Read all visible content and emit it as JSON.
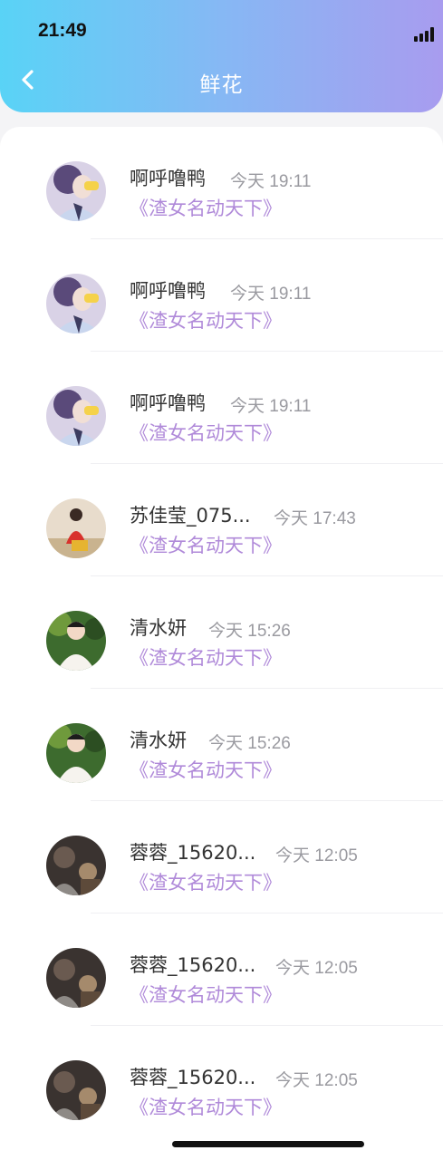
{
  "status_bar": {
    "time": "21:49"
  },
  "header": {
    "title": "鲜花",
    "back_icon": "chevron-left-icon"
  },
  "accent_colors": {
    "gradient_start": "#59d3f6",
    "gradient_end": "#a89cef",
    "book_text": "#b08ad9"
  },
  "list": [
    {
      "name": "啊呼噜鸭",
      "time": "今天 19:11",
      "book": "《渣女名动天下》",
      "avatar": "anime"
    },
    {
      "name": "啊呼噜鸭",
      "time": "今天 19:11",
      "book": "《渣女名动天下》",
      "avatar": "anime"
    },
    {
      "name": "啊呼噜鸭",
      "time": "今天 19:11",
      "book": "《渣女名动天下》",
      "avatar": "anime"
    },
    {
      "name": "苏佳莹_075...",
      "time": "今天 17:43",
      "book": "《渣女名动天下》",
      "avatar": "girl-red"
    },
    {
      "name": "清水妍",
      "time": "今天 15:26",
      "book": "《渣女名动天下》",
      "avatar": "boy-green"
    },
    {
      "name": "清水妍",
      "time": "今天 15:26",
      "book": "《渣女名动天下》",
      "avatar": "boy-green"
    },
    {
      "name": "蓉蓉_15620...",
      "time": "今天 12:05",
      "book": "《渣女名动天下》",
      "avatar": "dark-photo"
    },
    {
      "name": "蓉蓉_15620...",
      "time": "今天 12:05",
      "book": "《渣女名动天下》",
      "avatar": "dark-photo"
    },
    {
      "name": "蓉蓉_15620...",
      "time": "今天 12:05",
      "book": "《渣女名动天下》",
      "avatar": "dark-photo"
    }
  ]
}
